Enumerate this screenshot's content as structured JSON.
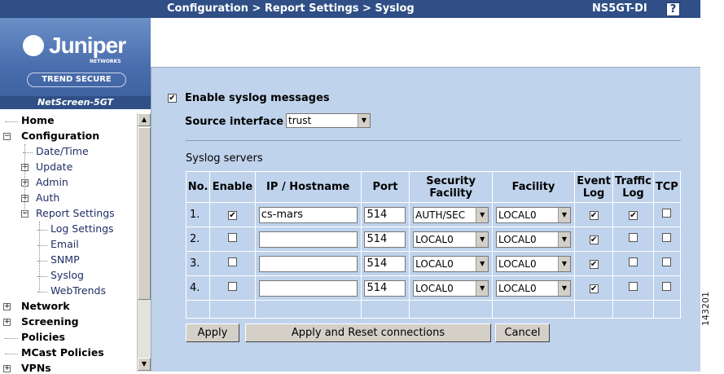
{
  "header": {
    "breadcrumb": "Configuration > Report Settings > Syslog",
    "device": "NS5GT-DI",
    "help_label": "?"
  },
  "sidebar": {
    "logo_text": "Juniper",
    "logo_sub": "NETWORKS",
    "trend_text": "TREND SECURE",
    "model": "NetScreen-5GT",
    "tree": [
      {
        "label": "Home",
        "bold": true
      },
      {
        "label": "Configuration",
        "bold": true,
        "toggle": "−"
      },
      {
        "label": "Date/Time"
      },
      {
        "label": "Update",
        "toggle": "+"
      },
      {
        "label": "Admin",
        "toggle": "+"
      },
      {
        "label": "Auth",
        "toggle": "+"
      },
      {
        "label": "Report Settings",
        "toggle": "−"
      },
      {
        "label": "Log Settings"
      },
      {
        "label": "Email"
      },
      {
        "label": "SNMP"
      },
      {
        "label": "Syslog"
      },
      {
        "label": "WebTrends"
      },
      {
        "label": "Network",
        "bold": true,
        "toggle": "+"
      },
      {
        "label": "Screening",
        "bold": true,
        "toggle": "+"
      },
      {
        "label": "Policies",
        "bold": true
      },
      {
        "label": "MCast Policies",
        "bold": true
      },
      {
        "label": "VPNs",
        "bold": true,
        "toggle": "+"
      }
    ]
  },
  "main": {
    "enable_syslog_label": "Enable syslog messages",
    "enable_syslog_checked": true,
    "source_interface_label": "Source interface",
    "source_interface_value": "trust",
    "servers_section_label": "Syslog servers",
    "columns": [
      "No.",
      "Enable",
      "IP / Hostname",
      "Port",
      "Security Facility",
      "Facility",
      "Event Log",
      "Traffic Log",
      "TCP"
    ],
    "rows": [
      {
        "no": "1.",
        "enable": true,
        "host": "cs-mars",
        "port": "514",
        "security_facility": "AUTH/SEC",
        "facility": "LOCAL0",
        "event": true,
        "traffic": true,
        "tcp": false
      },
      {
        "no": "2.",
        "enable": false,
        "host": "",
        "port": "514",
        "security_facility": "LOCAL0",
        "facility": "LOCAL0",
        "event": true,
        "traffic": false,
        "tcp": false
      },
      {
        "no": "3.",
        "enable": false,
        "host": "",
        "port": "514",
        "security_facility": "LOCAL0",
        "facility": "LOCAL0",
        "event": true,
        "traffic": false,
        "tcp": false
      },
      {
        "no": "4.",
        "enable": false,
        "host": "",
        "port": "514",
        "security_facility": "LOCAL0",
        "facility": "LOCAL0",
        "event": true,
        "traffic": false,
        "tcp": false
      }
    ],
    "buttons": {
      "apply": "Apply",
      "apply_reset": "Apply and Reset connections",
      "cancel": "Cancel"
    }
  },
  "figure_number": "143201"
}
